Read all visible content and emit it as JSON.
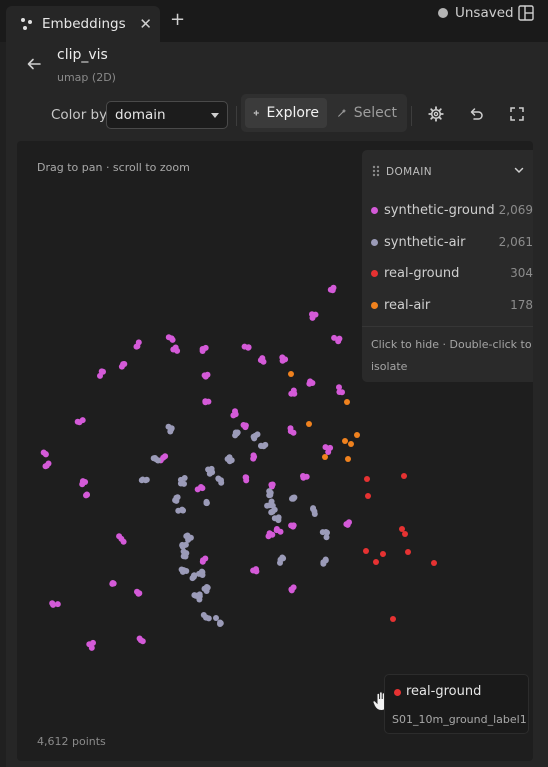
{
  "tab": {
    "title": "Embeddings",
    "close_glyph": "✕",
    "add_glyph": "+",
    "icon": "scatter-icon"
  },
  "status": {
    "unsaved_label": "Unsaved",
    "layout_icon": "panel-layout-icon"
  },
  "header": {
    "title": "clip_vis",
    "subtitle": "umap (2D)",
    "back_icon": "arrow-left-icon"
  },
  "toolbar": {
    "color_by_label": "Color by",
    "color_by_value": "domain",
    "explore_label": "Explore",
    "select_label": "Select",
    "mode_active": "Explore",
    "icons": [
      "gear-icon",
      "undo-icon",
      "fullscreen-icon"
    ]
  },
  "canvas": {
    "hint": "Drag to pan · scroll to zoom",
    "points_count": "4,612 points"
  },
  "legend": {
    "title": "DOMAIN",
    "items": [
      {
        "label": "synthetic-ground",
        "count": "2,069",
        "color": "#d45ad8"
      },
      {
        "label": "synthetic-air",
        "count": "2,061",
        "color": "#9b9bb8"
      },
      {
        "label": "real-ground",
        "count": "304",
        "color": "#e63232"
      },
      {
        "label": "real-air",
        "count": "178",
        "color": "#f0821e"
      }
    ],
    "footer": "Click to hide · Double-click to isolate"
  },
  "tooltip": {
    "label": "real-ground",
    "id": "S01_10m_ground_label1",
    "color": "#e63232"
  },
  "colors": {
    "background": "#202020",
    "panel": "#262626",
    "canvas": "#1e1e1e"
  }
}
